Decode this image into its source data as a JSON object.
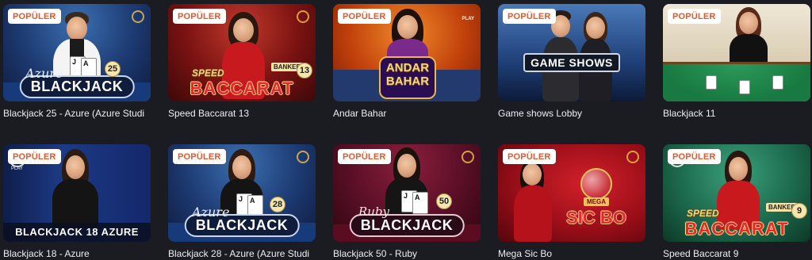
{
  "badge_label": "POPÜLER",
  "games": [
    {
      "title": "Blackjack 25 - Azure (Azure Studi",
      "logo": "BLACKJACK",
      "logo_prefix": "Azure",
      "number": "25"
    },
    {
      "title": "Speed Baccarat 13",
      "logo": "BACCARAT",
      "logo_prefix": "SPEED",
      "number": "13",
      "side_label": "BANKER"
    },
    {
      "title": "Andar Bahar",
      "logo_line1": "ANDAR",
      "logo_line2": "BAHAR",
      "corner_text": "PLAY"
    },
    {
      "title": "Game shows Lobby",
      "logo": "GAME SHOWS"
    },
    {
      "title": "Blackjack 11"
    },
    {
      "title": "Blackjack 18 - Azure",
      "logo": "BLACKJACK 18 AZURE",
      "corner_text": "PLAY"
    },
    {
      "title": "Blackjack 28 - Azure (Azure Studi",
      "logo": "BLACKJACK",
      "logo_prefix": "Azure",
      "number": "28"
    },
    {
      "title": "Blackjack 50 - Ruby",
      "logo": "BLACKJACK",
      "logo_prefix": "Ruby",
      "number": "50"
    },
    {
      "title": "Mega Sic Bo",
      "logo": "SIC BO",
      "logo_prefix": "MEGA"
    },
    {
      "title": "Speed Baccarat 9",
      "logo": "BACCARAT",
      "logo_prefix": "SPEED",
      "number": "9",
      "side_label": "BANKER"
    }
  ],
  "colors": {
    "background": "#1b1c22",
    "badge_text": "#e5582b",
    "badge_bg": "#ffffff",
    "caption": "#eceef2"
  }
}
